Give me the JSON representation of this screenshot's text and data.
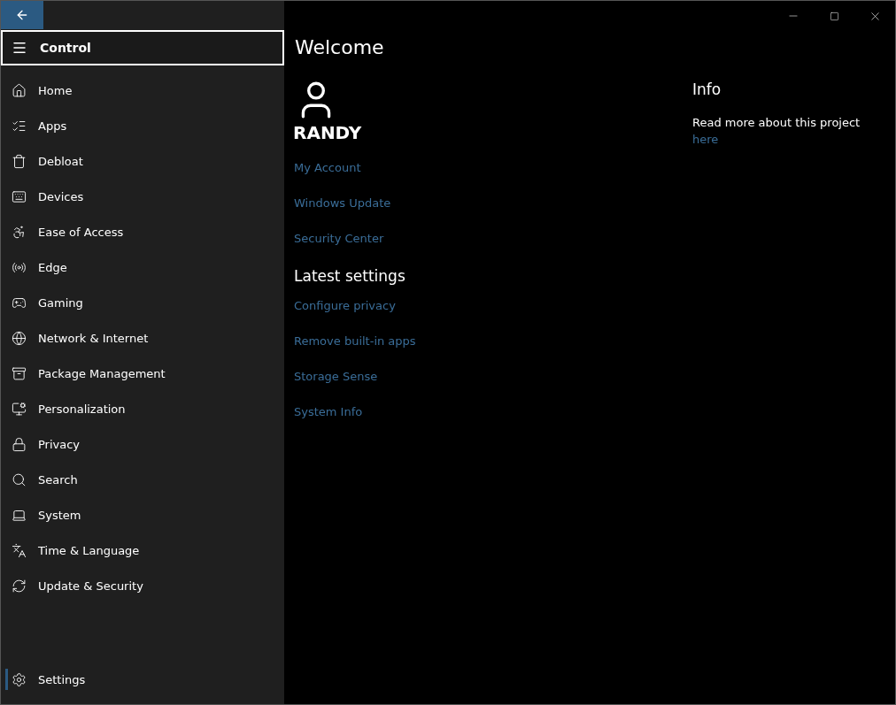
{
  "pane": {
    "title": "Control",
    "items": [
      {
        "label": "Home",
        "selected": false
      },
      {
        "label": "Apps",
        "selected": false
      },
      {
        "label": "Debloat",
        "selected": false
      },
      {
        "label": "Devices",
        "selected": false
      },
      {
        "label": "Ease of Access",
        "selected": false
      },
      {
        "label": "Edge",
        "selected": false
      },
      {
        "label": "Gaming",
        "selected": false
      },
      {
        "label": "Network & Internet",
        "selected": false
      },
      {
        "label": "Package Management",
        "selected": false
      },
      {
        "label": "Personalization",
        "selected": false
      },
      {
        "label": "Privacy",
        "selected": false
      },
      {
        "label": "Search",
        "selected": false
      },
      {
        "label": "System",
        "selected": false
      },
      {
        "label": "Time & Language",
        "selected": false
      },
      {
        "label": "Update & Security",
        "selected": false
      }
    ],
    "footer_item": {
      "label": "Settings",
      "selected": true
    }
  },
  "main": {
    "title": "Welcome",
    "user_name": "RANDY",
    "account_links": [
      "My Account",
      "Windows Update",
      "Security Center"
    ],
    "latest_heading": "Latest settings",
    "latest_links": [
      "Configure privacy",
      "Remove built-in apps",
      "Storage Sense",
      "System Info"
    ],
    "info": {
      "heading": "Info",
      "text": "Read more about this project",
      "link": "here"
    }
  }
}
